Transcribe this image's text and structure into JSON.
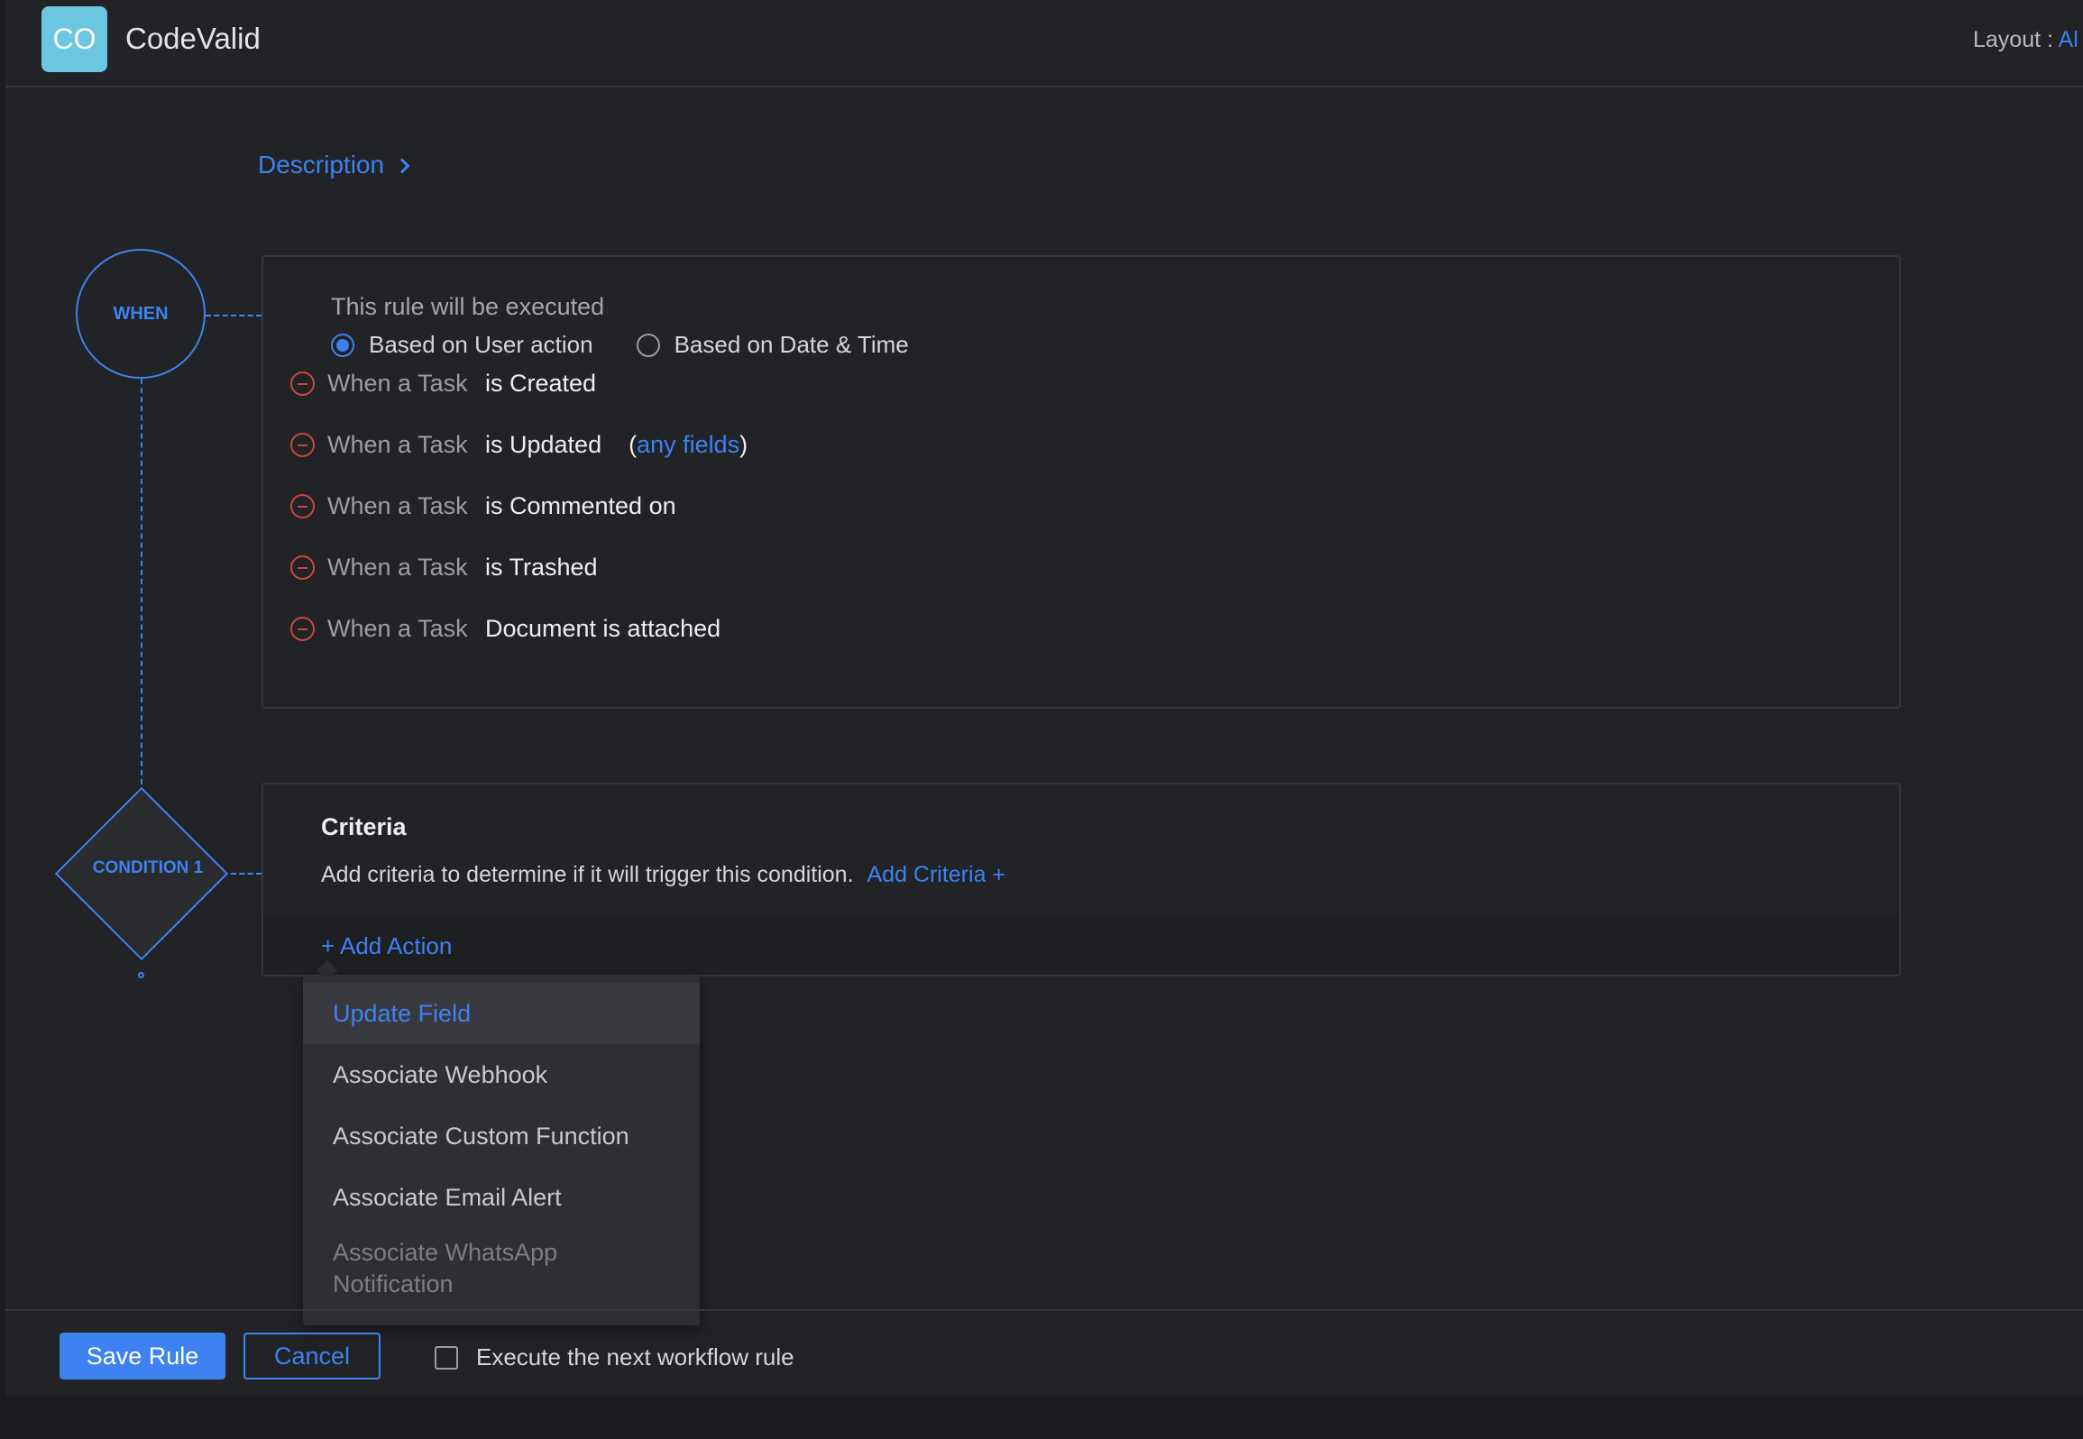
{
  "header": {
    "avatar_initials": "CO",
    "app_name": "CodeValid",
    "layout_label": "Layout :",
    "layout_value": "Al"
  },
  "description_link": "Description",
  "when_node": "WHEN",
  "condition_node": "CONDITION 1",
  "when_card": {
    "title": "This rule will be executed",
    "radio_options": [
      {
        "label": "Based on User action",
        "checked": true
      },
      {
        "label": "Based on Date & Time",
        "checked": false
      }
    ],
    "triggers": [
      {
        "subject": "When a Task",
        "event": "is Created"
      },
      {
        "subject": "When a Task",
        "event": "is Updated",
        "paren_open": "(",
        "link": "any fields",
        "paren_close": ")"
      },
      {
        "subject": "When a Task",
        "event": "is Commented on"
      },
      {
        "subject": "When a Task",
        "event": "is Trashed"
      },
      {
        "subject": "When a Task",
        "event": "Document is attached"
      }
    ]
  },
  "condition_card": {
    "title": "Criteria",
    "text": "Add criteria to determine if it will trigger this condition.",
    "add_criteria": "Add Criteria +",
    "add_action": "+ Add Action"
  },
  "action_menu": {
    "items": [
      {
        "label": "Update Field",
        "state": "active"
      },
      {
        "label": "Associate Webhook",
        "state": "normal"
      },
      {
        "label": "Associate Custom Function",
        "state": "normal"
      },
      {
        "label": "Associate Email Alert",
        "state": "normal"
      },
      {
        "label": "Associate WhatsApp Notification",
        "state": "disabled"
      }
    ]
  },
  "footer": {
    "save": "Save Rule",
    "cancel": "Cancel",
    "execute_next": "Execute the next workflow rule",
    "execute_next_checked": false
  },
  "colors": {
    "accent": "#3d82f0",
    "danger": "#c8463f",
    "background": "#222326",
    "avatar": "#6cc6e0"
  }
}
